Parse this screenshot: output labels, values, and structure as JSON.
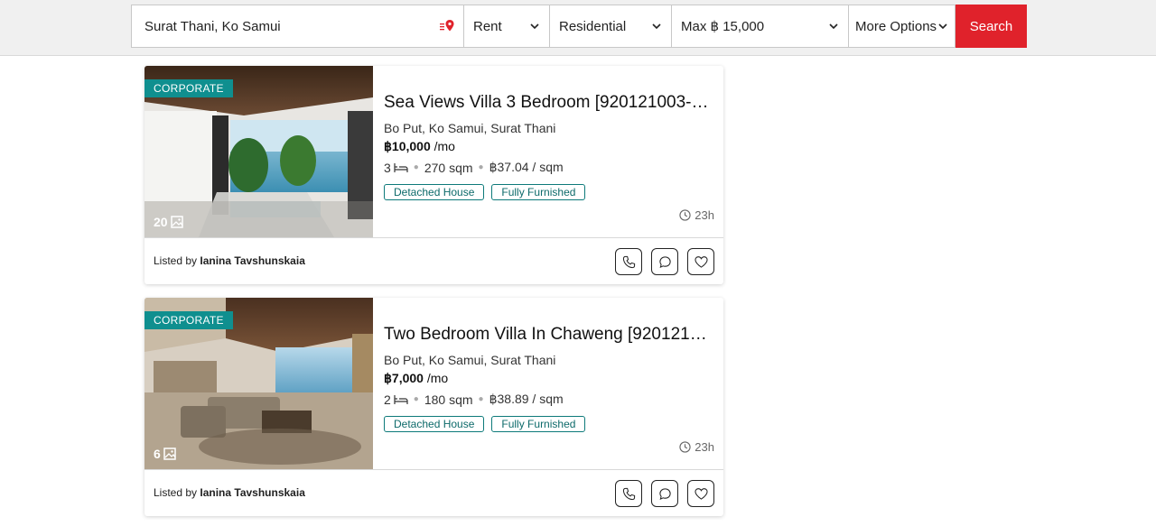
{
  "search": {
    "location_value": "Surat Thani, Ko Samui",
    "listing_type": "Rent",
    "property_type": "Residential",
    "max_price": "Max ฿ 15,000",
    "more_options": "More Options",
    "search_label": "Search"
  },
  "listings": [
    {
      "badge": "CORPORATE",
      "photo_count": "20",
      "title": "Sea Views Villa 3 Bedroom [920121003-1...",
      "address": "Bo Put, Ko Samui, Surat Thani",
      "price": "฿10,000",
      "price_unit": "/mo",
      "beds": "3",
      "area": "270 sqm",
      "price_per_sqm": "฿37.04 / sqm",
      "tags": [
        "Detached House",
        "Fully Furnished"
      ],
      "time_ago": "23h",
      "listed_by_label": "Listed by",
      "agent": "Ianina Tavshunskaia"
    },
    {
      "badge": "CORPORATE",
      "photo_count": "6",
      "title": "Two Bedroom Villa In Chaweng [9201210...",
      "address": "Bo Put, Ko Samui, Surat Thani",
      "price": "฿7,000",
      "price_unit": "/mo",
      "beds": "2",
      "area": "180 sqm",
      "price_per_sqm": "฿38.89 / sqm",
      "tags": [
        "Detached House",
        "Fully Furnished"
      ],
      "time_ago": "23h",
      "listed_by_label": "Listed by",
      "agent": "Ianina Tavshunskaia"
    }
  ],
  "colors": {
    "accent_red": "#e0222b",
    "badge_teal": "#0f8f8f",
    "tag_border": "#0d7a7a"
  }
}
